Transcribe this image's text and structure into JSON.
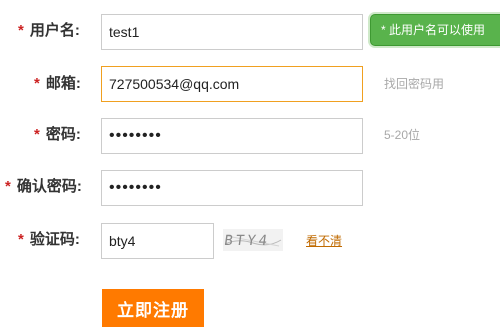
{
  "form": {
    "username": {
      "required_mark": "*",
      "label": "用户名:",
      "value": "test1",
      "tooltip": "* 此用户名可以使用"
    },
    "email": {
      "required_mark": "*",
      "label": "邮箱:",
      "value": "727500534@qq.com",
      "hint": "找回密码用"
    },
    "password": {
      "required_mark": "*",
      "label": "密码:",
      "value": "••••••••",
      "hint": "5-20位"
    },
    "confirm_password": {
      "required_mark": "*",
      "label": "确认密码:",
      "value": "••••••••"
    },
    "captcha": {
      "required_mark": "*",
      "label": "验证码:",
      "value": "bty4",
      "image_text": "BTY4",
      "refresh_link": "看不清"
    },
    "submit_label": "立即注册"
  },
  "colors": {
    "required_mark": "#cc2222",
    "focus_border": "#f0a020",
    "tooltip_bg": "#59b34c",
    "submit_bg": "#ff7a00",
    "link": "#c06a00"
  }
}
